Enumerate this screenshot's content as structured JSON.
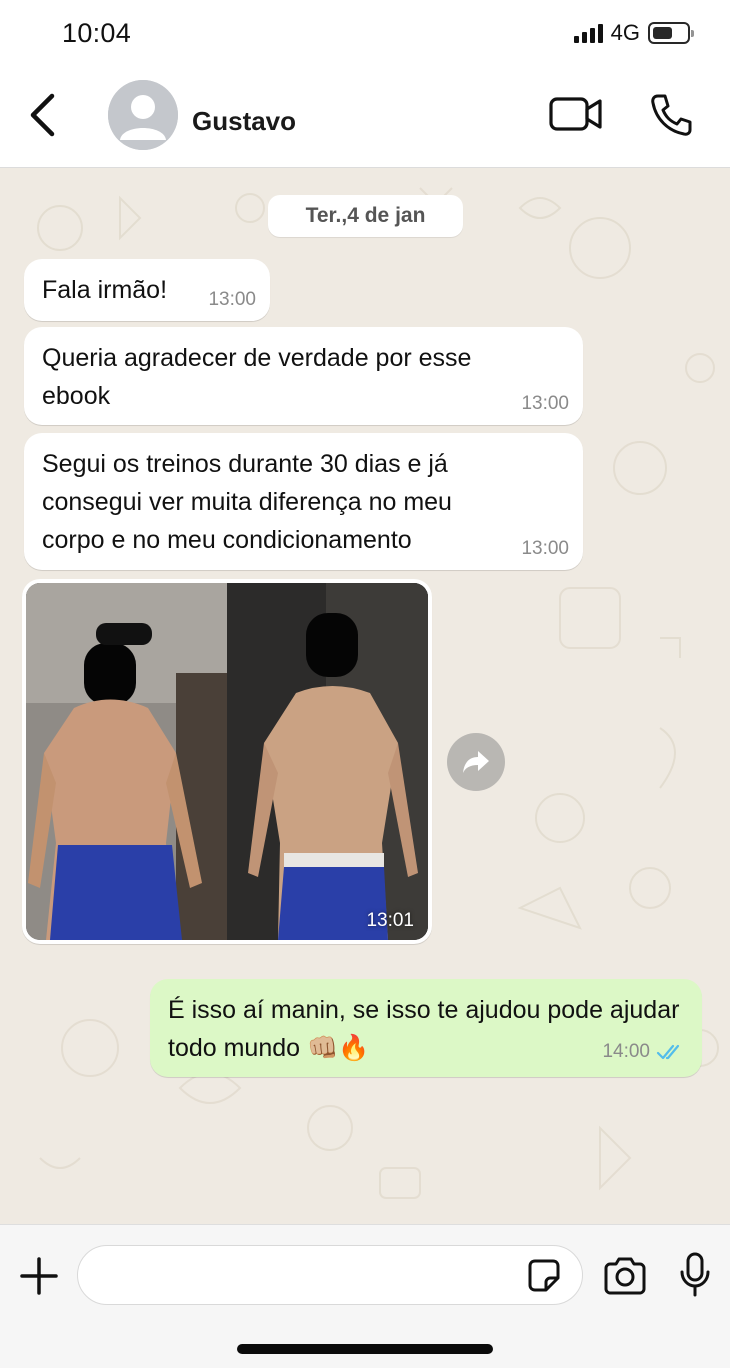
{
  "status_bar": {
    "time": "10:04",
    "network": "4G",
    "signal_bars": 4,
    "battery_level": 0.6
  },
  "header": {
    "contact_name": "Gustavo",
    "icons": {
      "back": "chevron-left-icon",
      "avatar": "default-user-avatar-icon",
      "video": "video-camera-icon",
      "call": "phone-icon"
    }
  },
  "chat": {
    "date_divider": "Ter.,4 de jan",
    "messages": [
      {
        "direction": "in",
        "type": "text",
        "text": "Fala irmão!",
        "time": "13:00"
      },
      {
        "direction": "in",
        "type": "text",
        "text": "Queria agradecer de verdade por esse ebook",
        "time": "13:00"
      },
      {
        "direction": "in",
        "type": "text",
        "text": "Segui os treinos durante 30 dias e já consegui ver muita diferença no meu corpo e no meu condicionamento",
        "time": "13:00"
      },
      {
        "direction": "in",
        "type": "image",
        "time": "13:01",
        "forward_icon": "forward-arrow-icon"
      },
      {
        "direction": "out",
        "type": "text",
        "text": "É isso aí manin, se isso te ajudou pode ajudar todo mundo 👊🏼🔥",
        "time": "14:00",
        "status": "read",
        "status_icon": "double-check-icon"
      }
    ]
  },
  "input_bar": {
    "placeholder": "",
    "value": "",
    "icons": {
      "attach": "plus-icon",
      "sticker": "sticker-icon",
      "camera": "camera-icon",
      "mic": "microphone-icon"
    }
  },
  "colors": {
    "chat_background": "#efeae2",
    "incoming_bubble": "#ffffff",
    "outgoing_bubble": "#dcf8c6",
    "read_tick": "#53bdeb"
  }
}
